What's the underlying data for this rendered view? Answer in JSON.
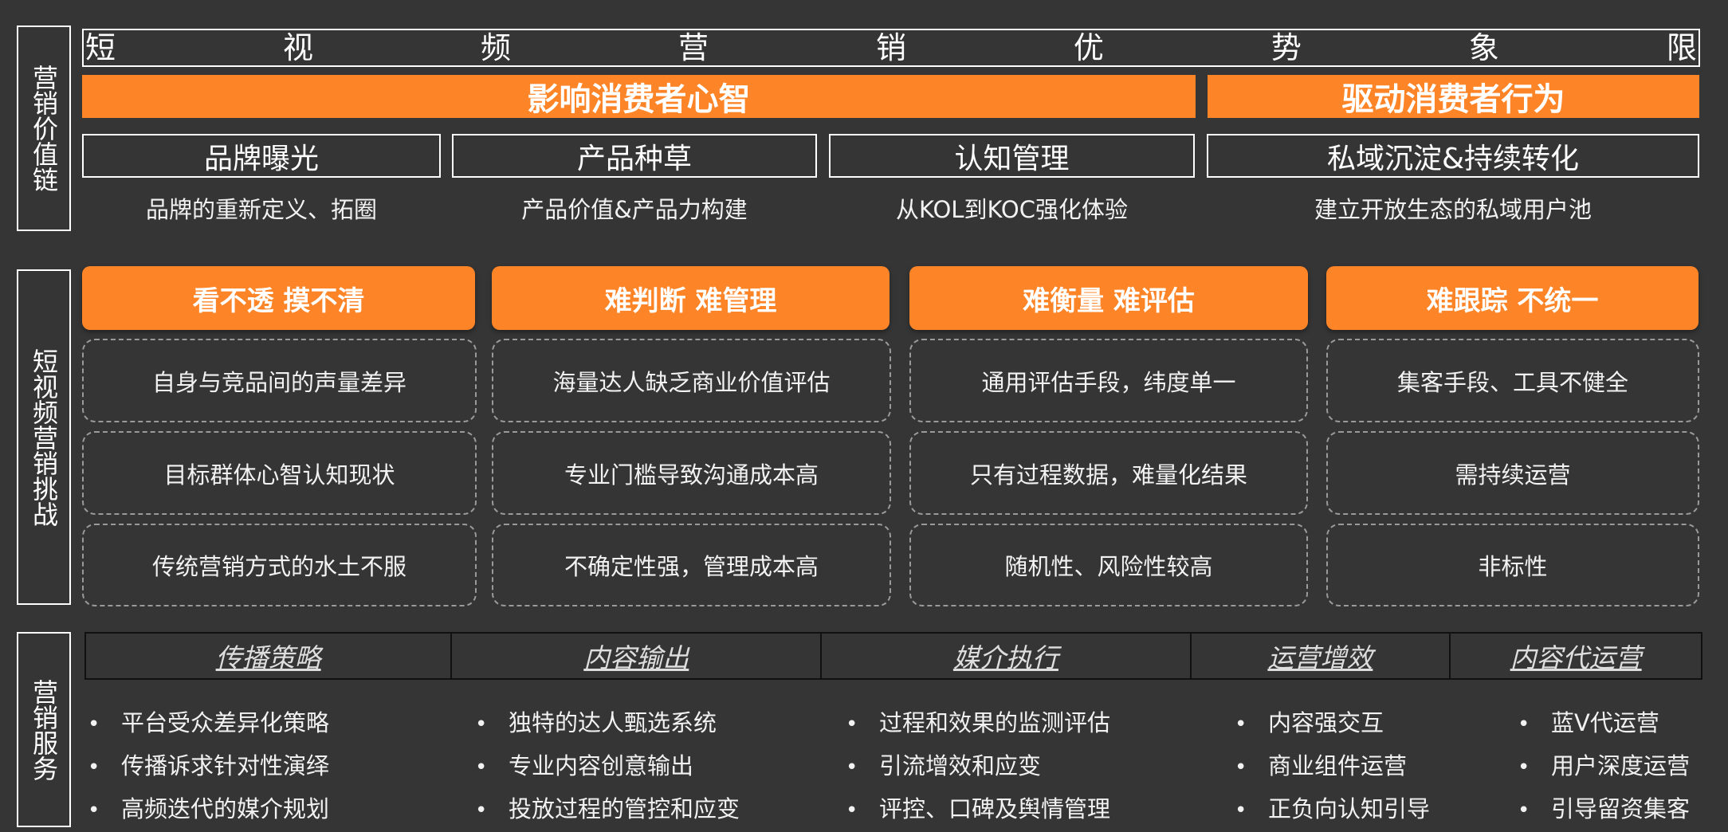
{
  "section_labels": {
    "value_chain": "营销价值链",
    "challenges": "短视频营销挑战",
    "services": "营销服务"
  },
  "title_chars": [
    "短",
    "视",
    "频",
    "营",
    "销",
    "优",
    "势",
    "象",
    "限"
  ],
  "bands": {
    "mind": "影响消费者心智",
    "behavior": "驱动消费者行为"
  },
  "value_boxes": [
    {
      "label": "品牌曝光",
      "desc": "品牌的重新定义、拓圈"
    },
    {
      "label": "产品种草",
      "desc": "产品价值&产品力构建"
    },
    {
      "label": "认知管理",
      "desc": "从KOL到KOC强化体验"
    },
    {
      "label": "私域沉淀&持续转化",
      "desc": "建立开放生态的私域用户池"
    }
  ],
  "challenges": [
    {
      "head": "看不透 摸不清",
      "items": [
        "自身与竞品间的声量差异",
        "目标群体心智认知现状",
        "传统营销方式的水土不服"
      ]
    },
    {
      "head": "难判断 难管理",
      "items": [
        "海量达人缺乏商业价值评估",
        "专业门槛导致沟通成本高",
        "不确定性强，管理成本高"
      ]
    },
    {
      "head": "难衡量 难评估",
      "items": [
        "通用评估手段，纬度单一",
        "只有过程数据，难量化结果",
        "随机性、风险性较高"
      ]
    },
    {
      "head": "难跟踪 不统一",
      "items": [
        "集客手段、工具不健全",
        "需持续运营",
        "非标性"
      ]
    }
  ],
  "services": [
    {
      "head": "传播策略",
      "items": [
        "平台受众差异化策略",
        "传播诉求针对性演绎",
        "高频迭代的媒介规划"
      ]
    },
    {
      "head": "内容输出",
      "items": [
        "独特的达人甄选系统",
        "专业内容创意输出",
        "投放过程的管控和应变"
      ]
    },
    {
      "head": "媒介执行",
      "items": [
        "过程和效果的监测评估",
        "引流增效和应变",
        "评控、口碑及舆情管理"
      ]
    },
    {
      "head": "运营增效",
      "items": [
        "内容强交互",
        "商业组件运营",
        "正负向认知引导"
      ]
    },
    {
      "head": "内容代运营",
      "items": [
        "蓝V代运营",
        "用户深度运营",
        "引导留资集客"
      ]
    }
  ],
  "bullet_symbol": "•",
  "colors": {
    "background": "#353535",
    "accent": "#fd8427",
    "text": "#ffffff",
    "dashed_border": "#9a9a9a"
  }
}
